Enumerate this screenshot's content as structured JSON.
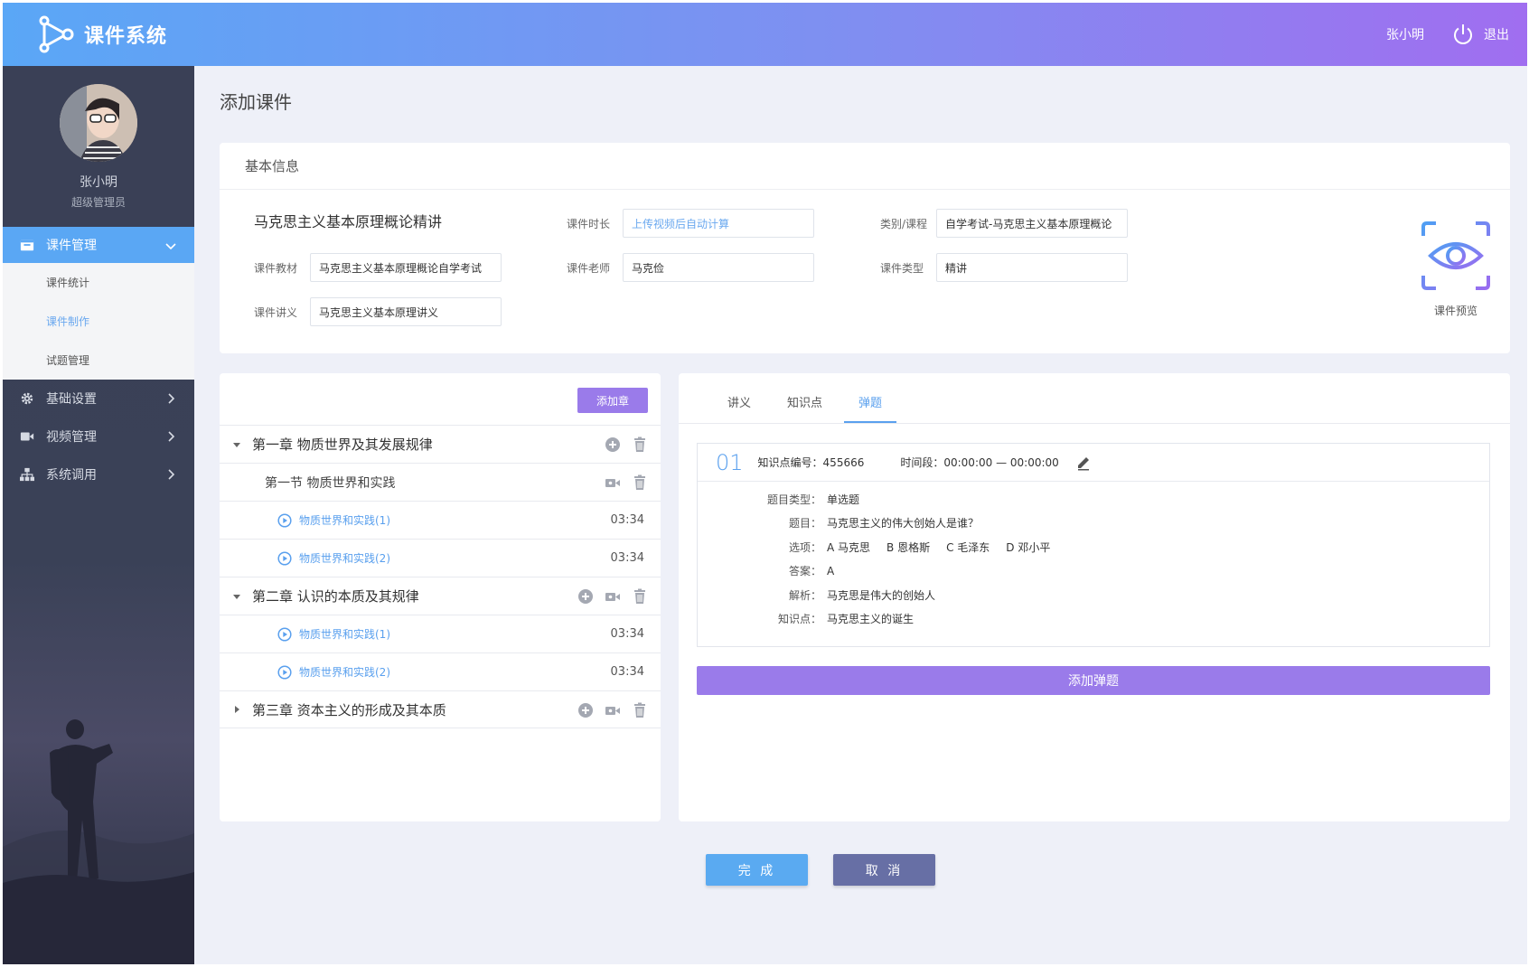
{
  "header": {
    "app_title": "课件系统",
    "user_name": "张小明",
    "logout_label": "退出"
  },
  "sidebar": {
    "profile": {
      "name": "张小明",
      "role": "超级管理员"
    },
    "menu": [
      {
        "label": "课件管理",
        "icon": "courseware-icon",
        "active": true
      },
      {
        "label": "基础设置",
        "icon": "gear-icon"
      },
      {
        "label": "视频管理",
        "icon": "video-icon"
      },
      {
        "label": "系统调用",
        "icon": "sitemap-icon"
      }
    ],
    "submenu": [
      {
        "label": "课件统计"
      },
      {
        "label": "课件制作",
        "current": true
      },
      {
        "label": "试题管理"
      }
    ]
  },
  "page": {
    "title": "添加课件"
  },
  "basic": {
    "heading": "基本信息",
    "course_name": "马克思主义基本原理概论精讲",
    "duration_label": "课件时长",
    "duration_placeholder": "上传视频后自动计算",
    "category_label": "类别/课程",
    "category_value": "自学考试-马克思主义基本原理概论",
    "textbook_label": "课件教材",
    "textbook_value": "马克思主义基本原理概论自学考试",
    "teacher_label": "课件老师",
    "teacher_value": "马克俭",
    "type_label": "课件类型",
    "type_value": "精讲",
    "handout_label": "课件讲义",
    "handout_value": "马克思主义基本原理讲义",
    "preview_label": "课件预览"
  },
  "tree": {
    "add_chapter_label": "添加章",
    "rows": [
      {
        "kind": "chapter",
        "label": "第一章  物质世界及其发展规律"
      },
      {
        "kind": "section",
        "label": "第一节 物质世界和实践"
      },
      {
        "kind": "lesson",
        "label": "物质世界和实践(1)",
        "time": "03:34"
      },
      {
        "kind": "lesson",
        "label": "物质世界和实践(2)",
        "time": "03:34"
      },
      {
        "kind": "chapter",
        "label": "第二章  认识的本质及其规律"
      },
      {
        "kind": "lesson",
        "label": "物质世界和实践(1)",
        "time": "03:34"
      },
      {
        "kind": "lesson",
        "label": "物质世界和实践(2)",
        "time": "03:34"
      },
      {
        "kind": "chapter",
        "label": "第三章  资本主义的形成及其本质"
      }
    ]
  },
  "quiz": {
    "tabs": [
      {
        "label": "讲义"
      },
      {
        "label": "知识点"
      },
      {
        "label": "弹题",
        "active": true
      }
    ],
    "item": {
      "number": "01",
      "kp_code": "知识点编号：455666",
      "time_range": "时间段：00:00:00 — 00:00:00",
      "type_key": "题目类型：",
      "type_val": "单选题",
      "question_key": "题目：",
      "question_val": "马克思主义的伟大创始人是谁？",
      "options_key": "选项：",
      "options": [
        "A 马克思",
        "B 恩格斯",
        "C 毛泽东",
        "D 邓小平"
      ],
      "answer_key": "答案：",
      "answer_val": "A",
      "analysis_key": "解析：",
      "analysis_val": "马克思是伟大的创始人",
      "kp_key": "知识点：",
      "kp_val": "马克思主义的诞生"
    },
    "add_label": "添加弹题"
  },
  "footer": {
    "done_label": "完 成",
    "cancel_label": "取 消"
  },
  "colors": {
    "accent_blue": "#5aa7f4",
    "accent_purple": "#9a7bea",
    "cancel": "#676fa5"
  }
}
